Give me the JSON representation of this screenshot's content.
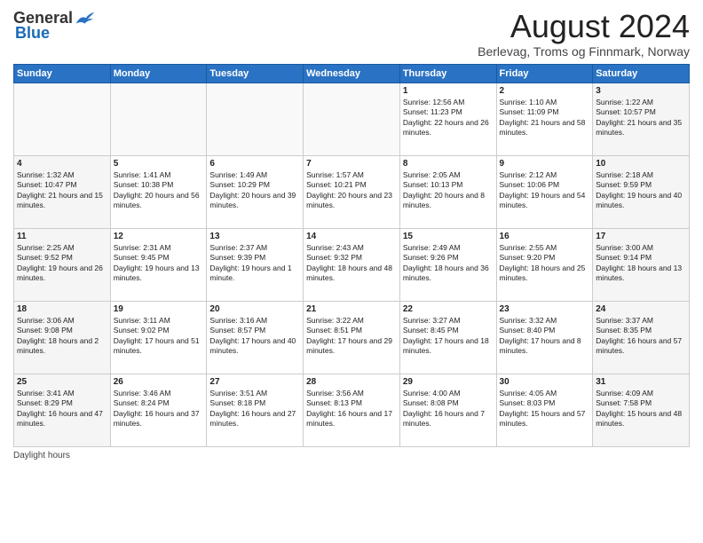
{
  "logo": {
    "general": "General",
    "blue": "Blue"
  },
  "title": "August 2024",
  "subtitle": "Berlevag, Troms og Finnmark, Norway",
  "days_header": [
    "Sunday",
    "Monday",
    "Tuesday",
    "Wednesday",
    "Thursday",
    "Friday",
    "Saturday"
  ],
  "footer": "Daylight hours",
  "weeks": [
    [
      {
        "day": "",
        "sunrise": "",
        "sunset": "",
        "daylight": ""
      },
      {
        "day": "",
        "sunrise": "",
        "sunset": "",
        "daylight": ""
      },
      {
        "day": "",
        "sunrise": "",
        "sunset": "",
        "daylight": ""
      },
      {
        "day": "",
        "sunrise": "",
        "sunset": "",
        "daylight": ""
      },
      {
        "day": "1",
        "sunrise": "Sunrise: 12:56 AM",
        "sunset": "Sunset: 11:23 PM",
        "daylight": "Daylight: 22 hours and 26 minutes."
      },
      {
        "day": "2",
        "sunrise": "Sunrise: 1:10 AM",
        "sunset": "Sunset: 11:09 PM",
        "daylight": "Daylight: 21 hours and 58 minutes."
      },
      {
        "day": "3",
        "sunrise": "Sunrise: 1:22 AM",
        "sunset": "Sunset: 10:57 PM",
        "daylight": "Daylight: 21 hours and 35 minutes."
      }
    ],
    [
      {
        "day": "4",
        "sunrise": "Sunrise: 1:32 AM",
        "sunset": "Sunset: 10:47 PM",
        "daylight": "Daylight: 21 hours and 15 minutes."
      },
      {
        "day": "5",
        "sunrise": "Sunrise: 1:41 AM",
        "sunset": "Sunset: 10:38 PM",
        "daylight": "Daylight: 20 hours and 56 minutes."
      },
      {
        "day": "6",
        "sunrise": "Sunrise: 1:49 AM",
        "sunset": "Sunset: 10:29 PM",
        "daylight": "Daylight: 20 hours and 39 minutes."
      },
      {
        "day": "7",
        "sunrise": "Sunrise: 1:57 AM",
        "sunset": "Sunset: 10:21 PM",
        "daylight": "Daylight: 20 hours and 23 minutes."
      },
      {
        "day": "8",
        "sunrise": "Sunrise: 2:05 AM",
        "sunset": "Sunset: 10:13 PM",
        "daylight": "Daylight: 20 hours and 8 minutes."
      },
      {
        "day": "9",
        "sunrise": "Sunrise: 2:12 AM",
        "sunset": "Sunset: 10:06 PM",
        "daylight": "Daylight: 19 hours and 54 minutes."
      },
      {
        "day": "10",
        "sunrise": "Sunrise: 2:18 AM",
        "sunset": "Sunset: 9:59 PM",
        "daylight": "Daylight: 19 hours and 40 minutes."
      }
    ],
    [
      {
        "day": "11",
        "sunrise": "Sunrise: 2:25 AM",
        "sunset": "Sunset: 9:52 PM",
        "daylight": "Daylight: 19 hours and 26 minutes."
      },
      {
        "day": "12",
        "sunrise": "Sunrise: 2:31 AM",
        "sunset": "Sunset: 9:45 PM",
        "daylight": "Daylight: 19 hours and 13 minutes."
      },
      {
        "day": "13",
        "sunrise": "Sunrise: 2:37 AM",
        "sunset": "Sunset: 9:39 PM",
        "daylight": "Daylight: 19 hours and 1 minute."
      },
      {
        "day": "14",
        "sunrise": "Sunrise: 2:43 AM",
        "sunset": "Sunset: 9:32 PM",
        "daylight": "Daylight: 18 hours and 48 minutes."
      },
      {
        "day": "15",
        "sunrise": "Sunrise: 2:49 AM",
        "sunset": "Sunset: 9:26 PM",
        "daylight": "Daylight: 18 hours and 36 minutes."
      },
      {
        "day": "16",
        "sunrise": "Sunrise: 2:55 AM",
        "sunset": "Sunset: 9:20 PM",
        "daylight": "Daylight: 18 hours and 25 minutes."
      },
      {
        "day": "17",
        "sunrise": "Sunrise: 3:00 AM",
        "sunset": "Sunset: 9:14 PM",
        "daylight": "Daylight: 18 hours and 13 minutes."
      }
    ],
    [
      {
        "day": "18",
        "sunrise": "Sunrise: 3:06 AM",
        "sunset": "Sunset: 9:08 PM",
        "daylight": "Daylight: 18 hours and 2 minutes."
      },
      {
        "day": "19",
        "sunrise": "Sunrise: 3:11 AM",
        "sunset": "Sunset: 9:02 PM",
        "daylight": "Daylight: 17 hours and 51 minutes."
      },
      {
        "day": "20",
        "sunrise": "Sunrise: 3:16 AM",
        "sunset": "Sunset: 8:57 PM",
        "daylight": "Daylight: 17 hours and 40 minutes."
      },
      {
        "day": "21",
        "sunrise": "Sunrise: 3:22 AM",
        "sunset": "Sunset: 8:51 PM",
        "daylight": "Daylight: 17 hours and 29 minutes."
      },
      {
        "day": "22",
        "sunrise": "Sunrise: 3:27 AM",
        "sunset": "Sunset: 8:45 PM",
        "daylight": "Daylight: 17 hours and 18 minutes."
      },
      {
        "day": "23",
        "sunrise": "Sunrise: 3:32 AM",
        "sunset": "Sunset: 8:40 PM",
        "daylight": "Daylight: 17 hours and 8 minutes."
      },
      {
        "day": "24",
        "sunrise": "Sunrise: 3:37 AM",
        "sunset": "Sunset: 8:35 PM",
        "daylight": "Daylight: 16 hours and 57 minutes."
      }
    ],
    [
      {
        "day": "25",
        "sunrise": "Sunrise: 3:41 AM",
        "sunset": "Sunset: 8:29 PM",
        "daylight": "Daylight: 16 hours and 47 minutes."
      },
      {
        "day": "26",
        "sunrise": "Sunrise: 3:46 AM",
        "sunset": "Sunset: 8:24 PM",
        "daylight": "Daylight: 16 hours and 37 minutes."
      },
      {
        "day": "27",
        "sunrise": "Sunrise: 3:51 AM",
        "sunset": "Sunset: 8:18 PM",
        "daylight": "Daylight: 16 hours and 27 minutes."
      },
      {
        "day": "28",
        "sunrise": "Sunrise: 3:56 AM",
        "sunset": "Sunset: 8:13 PM",
        "daylight": "Daylight: 16 hours and 17 minutes."
      },
      {
        "day": "29",
        "sunrise": "Sunrise: 4:00 AM",
        "sunset": "Sunset: 8:08 PM",
        "daylight": "Daylight: 16 hours and 7 minutes."
      },
      {
        "day": "30",
        "sunrise": "Sunrise: 4:05 AM",
        "sunset": "Sunset: 8:03 PM",
        "daylight": "Daylight: 15 hours and 57 minutes."
      },
      {
        "day": "31",
        "sunrise": "Sunrise: 4:09 AM",
        "sunset": "Sunset: 7:58 PM",
        "daylight": "Daylight: 15 hours and 48 minutes."
      }
    ]
  ]
}
